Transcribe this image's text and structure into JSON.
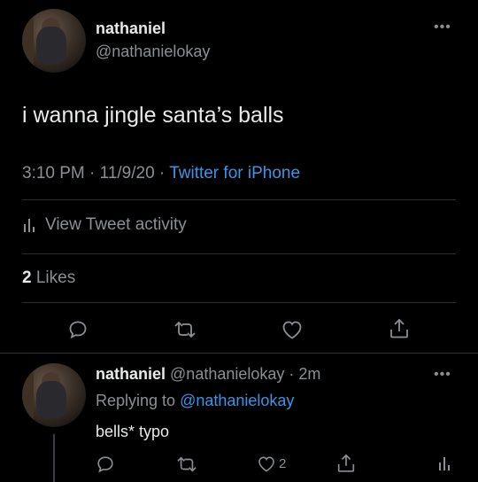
{
  "main_tweet": {
    "author_name": "nathaniel",
    "author_handle": "@nathanielokay",
    "text": "i wanna jingle santa’s balls",
    "time": "3:10 PM",
    "date": "11/9/20",
    "source": "Twitter for iPhone",
    "activity_label": "View Tweet activity",
    "likes_count": "2",
    "likes_label": "Likes"
  },
  "reply": {
    "author_name": "nathaniel",
    "author_handle": "@nathanielokay",
    "age": "2m",
    "replying_prefix": "Replying to",
    "replying_to": "@nathanielokay",
    "text": "bells* typo",
    "like_count": "2"
  },
  "icons": [
    "more-icon",
    "reply-icon",
    "retweet-icon",
    "like-icon",
    "share-icon",
    "activity-icon"
  ],
  "colors": {
    "background": "#000000",
    "link": "#3a95e8",
    "muted": "#8b8f94"
  }
}
